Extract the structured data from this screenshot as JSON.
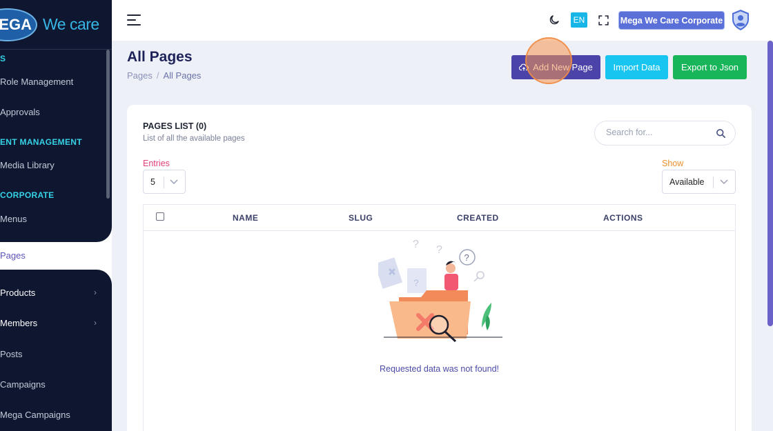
{
  "brand": {
    "logo_mark": "EGA",
    "logo_text": "We care"
  },
  "sidebar": {
    "sections": [
      {
        "label": "S"
      },
      {
        "label": "ENT MANAGEMENT"
      },
      {
        "label": " CORPORATE"
      }
    ],
    "items": [
      {
        "label": "Role Management"
      },
      {
        "label": "Approvals"
      },
      {
        "label": "Media Library"
      },
      {
        "label": "Menus"
      },
      {
        "label": "Pages"
      },
      {
        "label": "Products"
      },
      {
        "label": "Members"
      },
      {
        "label": "Posts"
      },
      {
        "label": "Campaigns"
      },
      {
        "label": "Mega Campaigns"
      }
    ]
  },
  "header": {
    "lang": "EN",
    "company": "Mega We Care Corporate"
  },
  "page": {
    "title": "All Pages",
    "breadcrumb": [
      "Pages",
      "All Pages"
    ],
    "breadcrumb_sep": "/"
  },
  "actions": {
    "add": "Add New Page",
    "import": "Import Data",
    "export": "Export to Json"
  },
  "card": {
    "title": "PAGES LIST (0)",
    "subtitle": "List of all the available pages",
    "search_placeholder": "Search for...",
    "entries_label": "Entries",
    "entries_value": "5",
    "show_label": "Show",
    "show_value": "Available"
  },
  "table": {
    "columns": [
      "NAME",
      "SLUG",
      "CREATED",
      "ACTIONS"
    ],
    "empty_message": "Requested data was not found!"
  },
  "colors": {
    "sidebar_bg": "#0e1630",
    "accent": "#4c43a8",
    "info": "#17c5f0",
    "success": "#18b55a"
  }
}
